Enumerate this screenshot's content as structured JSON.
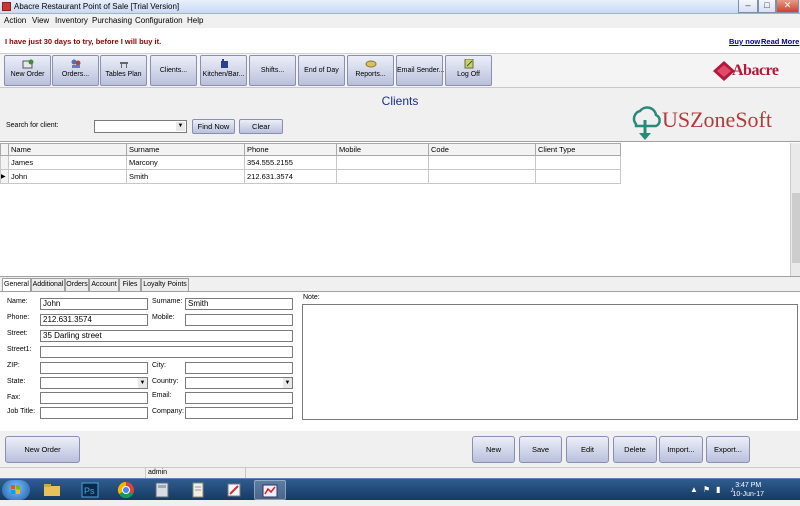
{
  "window": {
    "title": "Abacre Restaurant Point of Sale [Trial Version]",
    "minimize_glyph": "–",
    "maximize_glyph": "□",
    "close_glyph": "✕"
  },
  "menu": [
    "Action",
    "View",
    "Inventory",
    "Purchasing",
    "Configuration",
    "Help"
  ],
  "trial": {
    "message": "I have just 30 days to try, before I will buy it.",
    "buy_now": "Buy now",
    "read_more": "Read More"
  },
  "toolbar": [
    {
      "label": "New Order",
      "icon": "new-order-icon"
    },
    {
      "label": "Orders...",
      "icon": "orders-icon"
    },
    {
      "label": "Tables Plan",
      "icon": "tables-plan-icon"
    },
    {
      "label": "Clients...",
      "icon": "clients-icon"
    },
    {
      "label": "Kitchen/Bar...",
      "icon": "kitchen-icon"
    },
    {
      "label": "Shifts...",
      "icon": "shifts-icon"
    },
    {
      "label": "End of Day",
      "icon": "end-of-day-icon"
    },
    {
      "label": "Reports...",
      "icon": "reports-icon"
    },
    {
      "label": "Email Sender...",
      "icon": "email-icon"
    },
    {
      "label": "Log Off",
      "icon": "log-off-icon"
    }
  ],
  "logo_text": "Abacre",
  "page_title": "Clients",
  "watermark_text": "USZoneSoft",
  "search": {
    "label": "Search for client:",
    "value": "",
    "find_now": "Find Now",
    "clear": "Clear"
  },
  "grid": {
    "columns": [
      "Name",
      "Surname",
      "Phone",
      "Mobile",
      "Code",
      "Client Type"
    ],
    "rows": [
      {
        "name": "James",
        "surname": "Marcony",
        "phone": "354.555.2155",
        "mobile": "",
        "code": "",
        "client_type": "",
        "selected": false
      },
      {
        "name": "John",
        "surname": "Smith",
        "phone": "212.631.3574",
        "mobile": "",
        "code": "",
        "client_type": "",
        "selected": true
      }
    ]
  },
  "tabs": [
    "General",
    "Additional",
    "Orders",
    "Account",
    "Files",
    "Loyalty Points"
  ],
  "form": {
    "name_label": "Name:",
    "name_value": "John",
    "surname_label": "Surname:",
    "surname_value": "Smith",
    "phone_label": "Phone:",
    "phone_value": "212.631.3574",
    "mobile_label": "Mobile:",
    "mobile_value": "",
    "street_label": "Street:",
    "street_value": "35 Darling street",
    "street1_label": "Street1:",
    "street1_value": "",
    "zip_label": "ZIP:",
    "zip_value": "",
    "city_label": "City:",
    "city_value": "",
    "state_label": "State:",
    "state_value": "",
    "country_label": "Country:",
    "country_value": "",
    "email_label": "Email:",
    "email_value": "",
    "fax_label": "Fax:",
    "fax_value": "",
    "job_title_label": "Job Title:",
    "job_title_value": "",
    "company_label": "Company:",
    "company_value": "",
    "note_label": "Note:",
    "note_value": ""
  },
  "bottom_buttons": {
    "new_order": "New Order",
    "new": "New",
    "save": "Save",
    "edit": "Edit",
    "delete": "Delete",
    "import": "Import...",
    "export": "Export..."
  },
  "status": {
    "user": "admin"
  },
  "taskbar": {
    "time": "3:47 PM",
    "date": "10-Jun-17"
  },
  "colors": {
    "trial_text": "#8b0000",
    "title_text": "#1a2f8a",
    "logo": "#b2183a",
    "watermark": "#b23a3a",
    "watermark_icon": "#2a8a7a"
  }
}
